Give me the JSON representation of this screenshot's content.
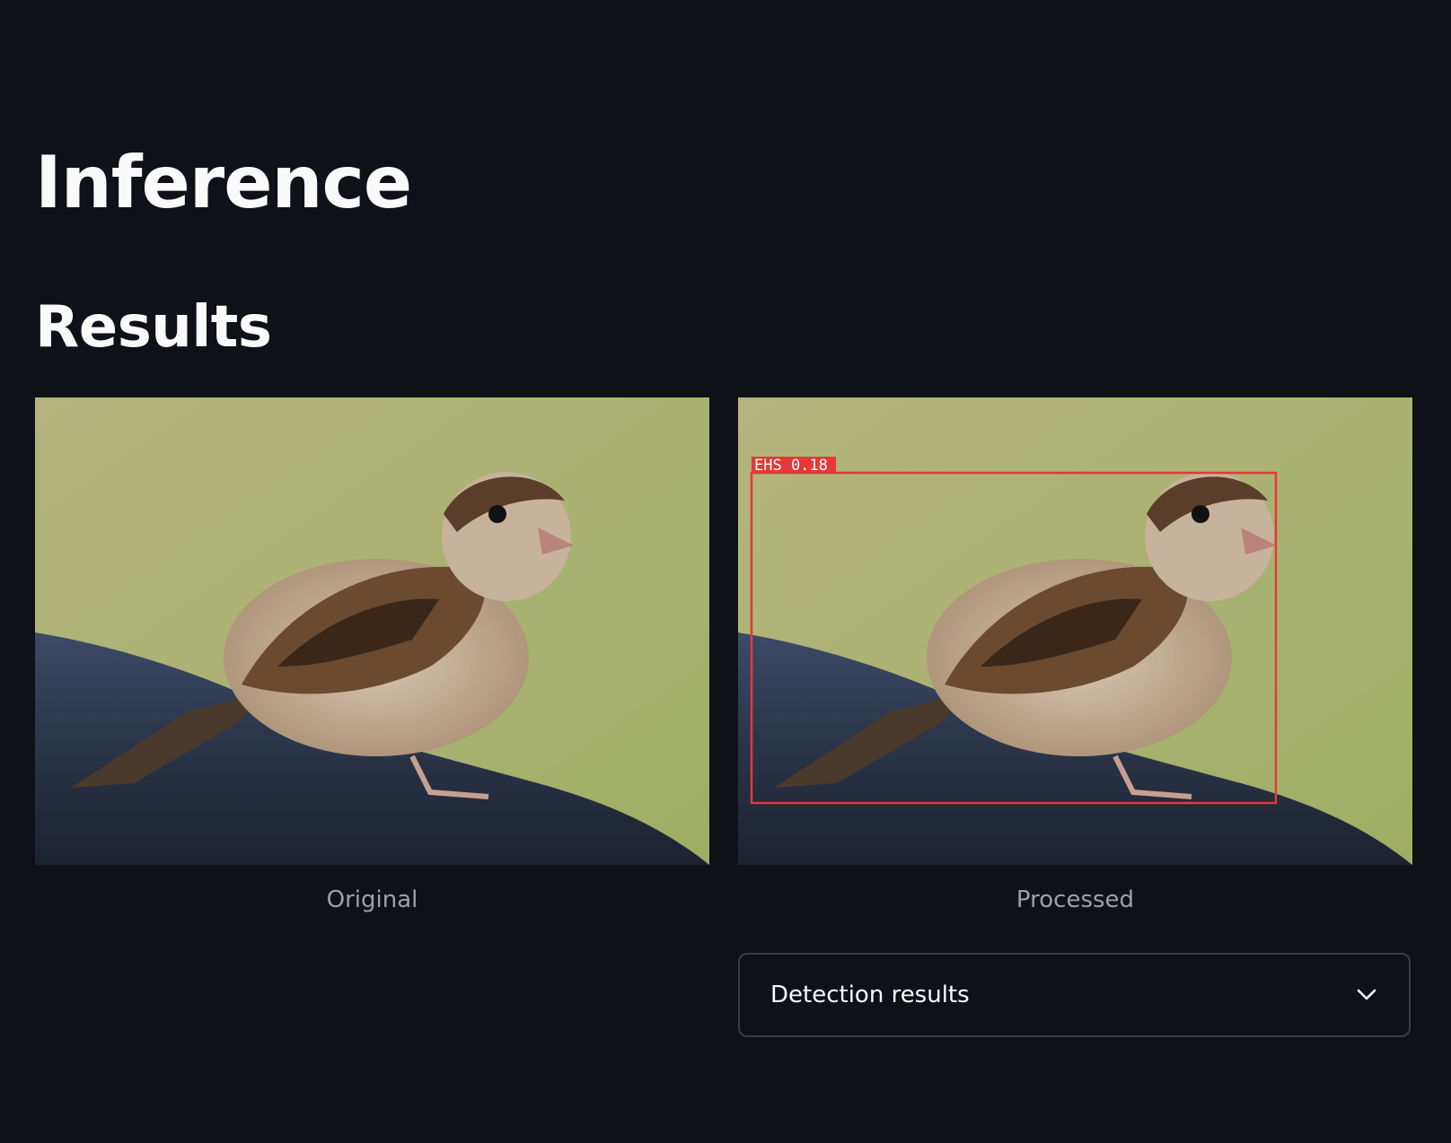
{
  "header": {
    "title": "Inference",
    "subtitle": "Results"
  },
  "images": {
    "original": {
      "caption": "Original",
      "content": "bird-photo"
    },
    "processed": {
      "caption": "Processed",
      "content": "bird-photo-with-detection-box",
      "detection": {
        "label": "EHS 0.18",
        "color": "#e53935"
      }
    }
  },
  "expander": {
    "label": "Detection results",
    "icon": "chevron-down-icon"
  },
  "colors": {
    "background": "#0e1117",
    "text": "#fafafa",
    "caption": "#9da0a8",
    "border": "#3a3d46"
  }
}
